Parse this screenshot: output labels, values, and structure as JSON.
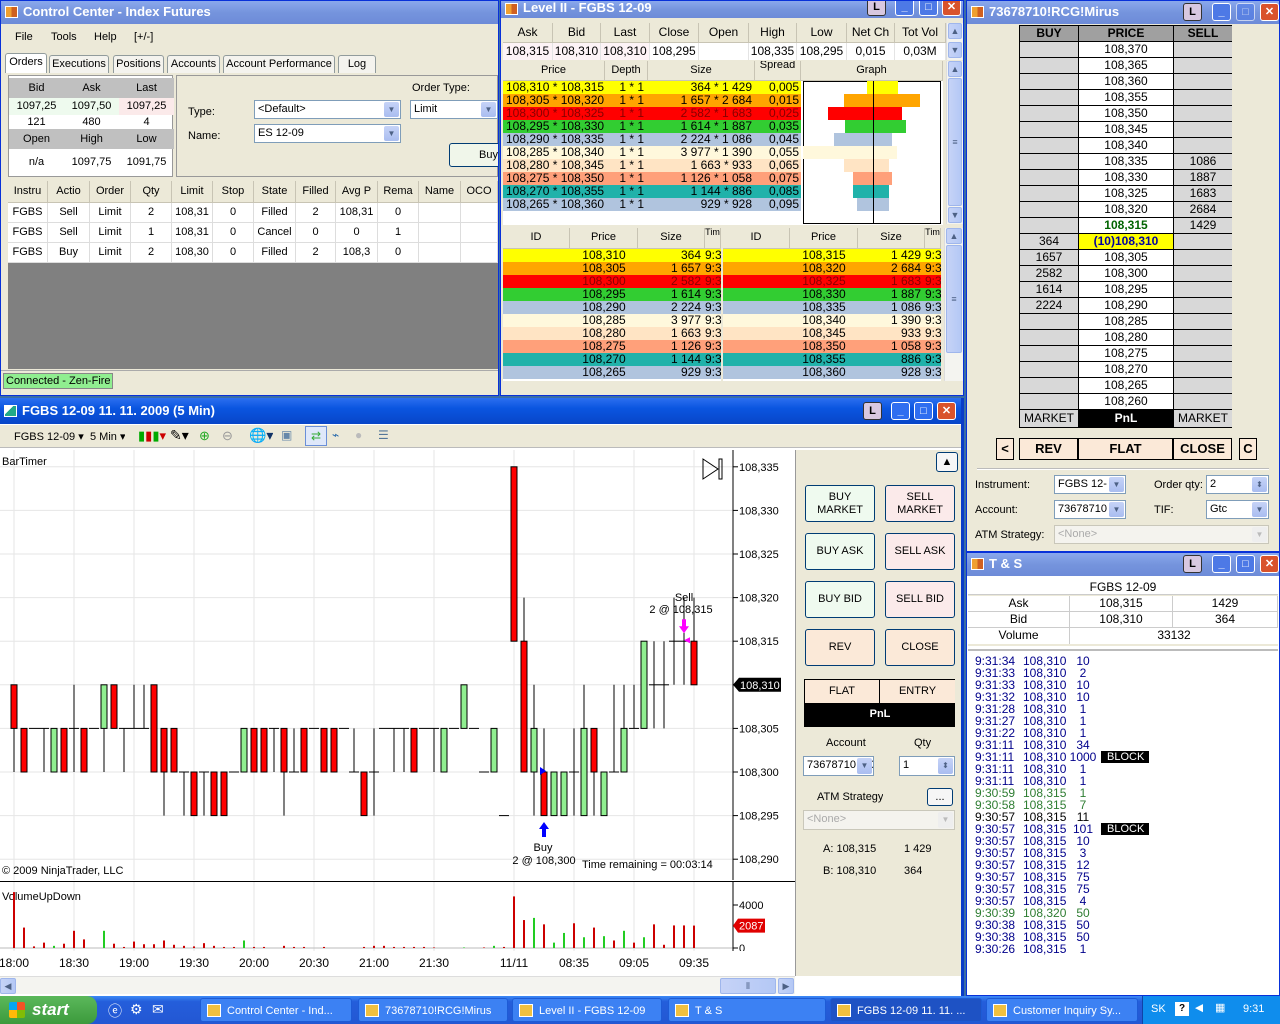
{
  "colors": {
    "up": "#90EE90",
    "down": "#FF0000",
    "book": [
      "#FFFF00",
      "#FFA500",
      "#FF0000",
      "#32CD32",
      "#B0C4DE",
      "#FFF8DC",
      "#FFE4C4",
      "#FFA07A",
      "#20B2AA",
      "#B0C4DE"
    ]
  },
  "control_center": {
    "title": "Control Center - Index Futures",
    "menu": [
      "File",
      "Tools",
      "Help",
      "[+/-]"
    ],
    "tabs": [
      "Orders",
      "Executions",
      "Positions",
      "Accounts",
      "Account Performance",
      "Log"
    ],
    "quote": {
      "headers": [
        "Bid",
        "Ask",
        "Last"
      ],
      "values": [
        "1097,25",
        "1097,50",
        "1097,25"
      ],
      "sizes": [
        "121",
        "480",
        "4"
      ],
      "headers2": [
        "Open",
        "High",
        "Low"
      ],
      "values2": [
        "n/a",
        "1097,75",
        "1091,75"
      ]
    },
    "order_entry": {
      "type_label": "Type:",
      "type_value": "<Default>",
      "name_label": "Name:",
      "name_value": "ES 12-09",
      "order_type_label": "Order Type:",
      "order_type_value": "Limit",
      "buy_label": "Buy"
    },
    "orders": {
      "columns": [
        "Instru",
        "Actio",
        "Order",
        "Qty",
        "Limit",
        "Stop",
        "State",
        "Filled",
        "Avg P",
        "Rema",
        "Name",
        "OCO"
      ],
      "rows": [
        [
          "FGBS",
          "Sell",
          "Limit",
          "2",
          "108,31",
          "0",
          "Filled",
          "2",
          "108,31",
          "0",
          "",
          ""
        ],
        [
          "FGBS",
          "Sell",
          "Limit",
          "1",
          "108,31",
          "0",
          "Cancel",
          "0",
          "0",
          "1",
          "",
          ""
        ],
        [
          "FGBS",
          "Buy",
          "Limit",
          "2",
          "108,30",
          "0",
          "Filled",
          "2",
          "108,3",
          "0",
          "",
          ""
        ]
      ]
    },
    "status": "Connected - Zen-Fire"
  },
  "level2": {
    "title": "Level II - FGBS 12-09",
    "summary": {
      "headers": [
        "Ask",
        "Bid",
        "Last",
        "Close",
        "Open",
        "High",
        "Low",
        "Net Ch",
        "Tot Vol"
      ],
      "values": [
        "108,315",
        "108,310",
        "108,310",
        "108,295",
        "",
        "108,335",
        "108,295",
        "0,015",
        "0,03M"
      ]
    },
    "book": {
      "columns": [
        "Price",
        "Depth",
        "Size",
        "Spread",
        "Graph"
      ],
      "rows": [
        {
          "price": "108,310 * 108,315",
          "depth": "1 * 1",
          "size": "364 * 1 429",
          "spread": "0,005",
          "bid": 364,
          "ask": 1429
        },
        {
          "price": "108,305 * 108,320",
          "depth": "1 * 1",
          "size": "1 657 * 2 684",
          "spread": "0,015",
          "bid": 1657,
          "ask": 2684
        },
        {
          "price": "108,300 * 108,325",
          "depth": "1 * 1",
          "size": "2 582 * 1 683",
          "spread": "0,025",
          "bid": 2582,
          "ask": 1683
        },
        {
          "price": "108,295 * 108,330",
          "depth": "1 * 1",
          "size": "1 614 * 1 887",
          "spread": "0,035",
          "bid": 1614,
          "ask": 1887
        },
        {
          "price": "108,290 * 108,335",
          "depth": "1 * 1",
          "size": "2 224 * 1 086",
          "spread": "0,045",
          "bid": 2224,
          "ask": 1086
        },
        {
          "price": "108,285 * 108,340",
          "depth": "1 * 1",
          "size": "3 977 * 1 390",
          "spread": "0,055",
          "bid": 3977,
          "ask": 1390
        },
        {
          "price": "108,280 * 108,345",
          "depth": "1 * 1",
          "size": "1 663 * 933",
          "spread": "0,065",
          "bid": 1663,
          "ask": 933
        },
        {
          "price": "108,275 * 108,350",
          "depth": "1 * 1",
          "size": "1 126 * 1 058",
          "spread": "0,075",
          "bid": 1126,
          "ask": 1058
        },
        {
          "price": "108,270 * 108,355",
          "depth": "1 * 1",
          "size": "1 144 * 886",
          "spread": "0,085",
          "bid": 1144,
          "ask": 886
        },
        {
          "price": "108,265 * 108,360",
          "depth": "1 * 1",
          "size": "929 * 928",
          "spread": "0,095",
          "bid": 929,
          "ask": 928
        }
      ]
    },
    "side_columns": [
      "ID",
      "Price",
      "Size",
      "Tim"
    ],
    "bids": [
      [
        "108,310",
        "364"
      ],
      [
        "108,305",
        "1 657"
      ],
      [
        "108,300",
        "2 582"
      ],
      [
        "108,295",
        "1 614"
      ],
      [
        "108,290",
        "2 224"
      ],
      [
        "108,285",
        "3 977"
      ],
      [
        "108,280",
        "1 663"
      ],
      [
        "108,275",
        "1 126"
      ],
      [
        "108,270",
        "1 144"
      ],
      [
        "108,265",
        "929"
      ]
    ],
    "asks": [
      [
        "108,315",
        "1 429"
      ],
      [
        "108,320",
        "2 684"
      ],
      [
        "108,325",
        "1 683"
      ],
      [
        "108,330",
        "1 887"
      ],
      [
        "108,335",
        "1 086"
      ],
      [
        "108,340",
        "1 390"
      ],
      [
        "108,345",
        "933"
      ],
      [
        "108,350",
        "1 058"
      ],
      [
        "108,355",
        "886"
      ],
      [
        "108,360",
        "928"
      ]
    ],
    "time_value": "9:3"
  },
  "dom": {
    "title": "73678710!RCG!Mirus",
    "columns": [
      "BUY",
      "PRICE",
      "SELL"
    ],
    "rows": [
      [
        "",
        "108,370",
        ""
      ],
      [
        "",
        "108,365",
        ""
      ],
      [
        "",
        "108,360",
        ""
      ],
      [
        "",
        "108,355",
        ""
      ],
      [
        "",
        "108,350",
        ""
      ],
      [
        "",
        "108,345",
        ""
      ],
      [
        "",
        "108,340",
        ""
      ],
      [
        "",
        "108,335",
        "1086"
      ],
      [
        "",
        "108,330",
        "1887"
      ],
      [
        "",
        "108,325",
        "1683"
      ],
      [
        "",
        "108,320",
        "2684"
      ],
      [
        "",
        "108,315",
        "1429"
      ],
      [
        "364",
        "(10)108,310",
        ""
      ],
      [
        "1657",
        "108,305",
        ""
      ],
      [
        "2582",
        "108,300",
        ""
      ],
      [
        "1614",
        "108,295",
        ""
      ],
      [
        "2224",
        "108,290",
        ""
      ],
      [
        "",
        "108,285",
        ""
      ],
      [
        "",
        "108,280",
        ""
      ],
      [
        "",
        "108,275",
        ""
      ],
      [
        "",
        "108,270",
        ""
      ],
      [
        "",
        "108,265",
        ""
      ],
      [
        "",
        "108,260",
        ""
      ]
    ],
    "last_index": 12,
    "ask_index": 11,
    "footer": [
      "MARKET",
      "PnL",
      "MARKET"
    ],
    "buttons": [
      "<",
      "REV",
      "FLAT",
      "CLOSE",
      "C"
    ],
    "instrument_label": "Instrument:",
    "instrument_value": "FGBS 12-",
    "account_label": "Account:",
    "account_value": "73678710",
    "qty_label": "Order qty:",
    "qty_value": "2",
    "tif_label": "TIF:",
    "tif_value": "Gtc",
    "atm_label": "ATM Strategy:",
    "atm_value": "<None>"
  },
  "ts": {
    "title": "T & S",
    "instrument": "FGBS 12-09",
    "rows": [
      [
        "Ask",
        "108,315",
        "1429"
      ],
      [
        "Bid",
        "108,310",
        "364"
      ]
    ],
    "volume_label": "Volume",
    "volume_value": "33132",
    "trades": [
      [
        "9:31:34",
        "108,310",
        "10",
        "",
        "b"
      ],
      [
        "9:31:33",
        "108,310",
        "2",
        "",
        "b"
      ],
      [
        "9:31:33",
        "108,310",
        "10",
        "",
        "b"
      ],
      [
        "9:31:32",
        "108,310",
        "10",
        "",
        "b"
      ],
      [
        "9:31:28",
        "108,310",
        "1",
        "",
        "b"
      ],
      [
        "9:31:27",
        "108,310",
        "1",
        "",
        "b"
      ],
      [
        "9:31:22",
        "108,310",
        "1",
        "",
        "b"
      ],
      [
        "9:31:11",
        "108,310",
        "34",
        "",
        "b"
      ],
      [
        "9:31:11",
        "108,310",
        "1000",
        "BLOCK",
        "b"
      ],
      [
        "9:31:11",
        "108,310",
        "1",
        "",
        "b"
      ],
      [
        "9:31:11",
        "108,310",
        "1",
        "",
        "b"
      ],
      [
        "9:30:59",
        "108,315",
        "1",
        "",
        "g"
      ],
      [
        "9:30:58",
        "108,315",
        "7",
        "",
        "g"
      ],
      [
        "9:30:57",
        "108,315",
        "11",
        "",
        "k"
      ],
      [
        "9:30:57",
        "108,315",
        "101",
        "BLOCK",
        "b"
      ],
      [
        "9:30:57",
        "108,315",
        "10",
        "",
        "b"
      ],
      [
        "9:30:57",
        "108,315",
        "3",
        "",
        "b"
      ],
      [
        "9:30:57",
        "108,315",
        "12",
        "",
        "b"
      ],
      [
        "9:30:57",
        "108,315",
        "75",
        "",
        "b"
      ],
      [
        "9:30:57",
        "108,315",
        "75",
        "",
        "b"
      ],
      [
        "9:30:57",
        "108,315",
        "4",
        "",
        "b"
      ],
      [
        "9:30:39",
        "108,320",
        "50",
        "",
        "g"
      ],
      [
        "9:30:38",
        "108,315",
        "50",
        "",
        "b"
      ],
      [
        "9:30:38",
        "108,315",
        "50",
        "",
        "b"
      ],
      [
        "9:30:26",
        "108,315",
        "1",
        "",
        "b"
      ]
    ]
  },
  "chart": {
    "title": "FGBS 12-09  11. 11. 2009 (5 Min)",
    "toolbar": {
      "instrument": "FGBS 12-09",
      "interval": "5 Min"
    },
    "bar_timer": "BarTimer",
    "copyright": "© 2009 NinjaTrader, LLC",
    "time_remaining": "Time remaining = 00:03:14",
    "indicator": "VolumeUpDown",
    "panel": {
      "buy_market": "BUY MARKET",
      "sell_market": "SELL MARKET",
      "buy_ask": "BUY ASK",
      "sell_ask": "SELL ASK",
      "buy_bid": "BUY BID",
      "sell_bid": "SELL BID",
      "rev": "REV",
      "close": "CLOSE",
      "flat": "FLAT",
      "entry": "ENTRY",
      "pnl": "PnL",
      "account_label": "Account",
      "account_value": "73678710!RC",
      "qty_label": "Qty",
      "qty_value": "1",
      "atm_label": "ATM Strategy",
      "atm_button": "...",
      "atm_value": "<None>",
      "ask_line": "A: 108,315",
      "ask_size": "1 429",
      "bid_line": "B: 108,310",
      "bid_size": "364"
    }
  },
  "chart_data": {
    "type": "candlestick",
    "title": "FGBS 12-09  11. 11. 2009 (5 Min)",
    "ylim": [
      108.29,
      108.335
    ],
    "y_ticks": [
      "108,290",
      "108,295",
      "108,300",
      "108,305",
      "108,310",
      "108,315",
      "108,320",
      "108,325",
      "108,330",
      "108,335"
    ],
    "last_price": "108,310",
    "last_price_value": 108.31,
    "x_labels": [
      {
        "i": 0,
        "t": "18:00"
      },
      {
        "i": 6,
        "t": "18:30"
      },
      {
        "i": 12,
        "t": "19:00"
      },
      {
        "i": 18,
        "t": "19:30"
      },
      {
        "i": 24,
        "t": "20:00"
      },
      {
        "i": 30,
        "t": "20:30"
      },
      {
        "i": 36,
        "t": "21:00"
      },
      {
        "i": 42,
        "t": "21:30"
      },
      {
        "i": 50,
        "t": "11/11"
      },
      {
        "i": 56,
        "t": "08:35"
      },
      {
        "i": 62,
        "t": "09:05"
      },
      {
        "i": 68,
        "t": "09:35"
      }
    ],
    "ohlc": [
      [
        108.31,
        108.31,
        108.3,
        108.305
      ],
      [
        108.305,
        108.305,
        108.3,
        108.3
      ],
      [
        108.305,
        108.305,
        108.305,
        108.305
      ],
      [
        108.305,
        108.305,
        108.3,
        108.305
      ],
      [
        108.3,
        108.305,
        108.3,
        108.305
      ],
      [
        108.305,
        108.305,
        108.3,
        108.3
      ],
      [
        108.305,
        108.31,
        108.3,
        108.305
      ],
      [
        108.305,
        108.305,
        108.3,
        108.3
      ],
      [
        108.305,
        108.305,
        108.305,
        108.305
      ],
      [
        108.305,
        108.31,
        108.3,
        108.31
      ],
      [
        108.31,
        108.31,
        108.305,
        108.305
      ],
      [
        108.305,
        108.305,
        108.3,
        108.305
      ],
      [
        108.305,
        108.31,
        108.305,
        108.305
      ],
      [
        108.305,
        108.31,
        108.305,
        108.305
      ],
      [
        108.31,
        108.31,
        108.3,
        108.3
      ],
      [
        108.305,
        108.305,
        108.295,
        108.3
      ],
      [
        108.305,
        108.305,
        108.3,
        108.3
      ],
      [
        108.3,
        108.3,
        108.295,
        108.3
      ],
      [
        108.3,
        108.3,
        108.295,
        108.295
      ],
      [
        108.3,
        108.3,
        108.295,
        108.3
      ],
      [
        108.3,
        108.3,
        108.295,
        108.295
      ],
      [
        108.3,
        108.3,
        108.295,
        108.295
      ],
      [
        108.3,
        108.3,
        108.3,
        108.3
      ],
      [
        108.3,
        108.305,
        108.3,
        108.305
      ],
      [
        108.305,
        108.305,
        108.3,
        108.3
      ],
      [
        108.305,
        108.305,
        108.3,
        108.3
      ],
      [
        108.305,
        108.305,
        108.3,
        108.305
      ],
      [
        108.305,
        108.305,
        108.295,
        108.3
      ],
      [
        108.3,
        108.305,
        108.3,
        108.3
      ],
      [
        108.305,
        108.305,
        108.3,
        108.3
      ],
      [
        108.305,
        108.305,
        108.305,
        108.305
      ],
      [
        108.305,
        108.305,
        108.3,
        108.3
      ],
      [
        108.305,
        108.305,
        108.3,
        108.3
      ],
      [
        108.305,
        108.305,
        108.305,
        108.305
      ],
      [
        108.3,
        108.305,
        108.3,
        108.3
      ],
      [
        108.3,
        108.3,
        108.295,
        108.295
      ],
      [
        108.3,
        108.305,
        108.295,
        108.3
      ],
      [
        108.305,
        108.305,
        108.305,
        108.305
      ],
      [
        108.305,
        108.305,
        108.3,
        108.305
      ],
      [
        108.305,
        108.305,
        108.3,
        108.305
      ],
      [
        108.305,
        108.305,
        108.3,
        108.3
      ],
      [
        108.305,
        108.305,
        108.305,
        108.305
      ],
      [
        108.305,
        108.305,
        108.3,
        108.305
      ],
      [
        108.3,
        108.305,
        108.3,
        108.305
      ],
      [
        108.305,
        108.305,
        108.305,
        108.305
      ],
      [
        108.305,
        108.31,
        108.305,
        108.31
      ],
      [
        108.305,
        108.305,
        108.305,
        108.305
      ],
      [
        108.3,
        108.3,
        108.3,
        108.3
      ],
      [
        108.3,
        108.305,
        108.3,
        108.305
      ],
      [
        108.295,
        108.295,
        108.295,
        108.295
      ],
      [
        108.335,
        108.335,
        108.315,
        108.315
      ],
      [
        108.315,
        108.32,
        108.3,
        108.3
      ],
      [
        108.3,
        108.31,
        108.295,
        108.305
      ],
      [
        108.3,
        108.305,
        108.295,
        108.295
      ],
      [
        108.295,
        108.3,
        108.295,
        108.3
      ],
      [
        108.295,
        108.3,
        108.295,
        108.3
      ],
      [
        108.3,
        108.305,
        108.295,
        108.3
      ],
      [
        108.295,
        108.31,
        108.295,
        108.305
      ],
      [
        108.305,
        108.305,
        108.295,
        108.3
      ],
      [
        108.295,
        108.3,
        108.295,
        108.3
      ],
      [
        108.3,
        108.31,
        108.3,
        108.3
      ],
      [
        108.3,
        108.31,
        108.3,
        108.305
      ],
      [
        108.305,
        108.31,
        108.305,
        108.305
      ],
      [
        108.305,
        108.315,
        108.305,
        108.315
      ],
      [
        108.31,
        108.315,
        108.305,
        108.31
      ],
      [
        108.31,
        108.315,
        108.305,
        108.31
      ],
      [
        108.315,
        108.32,
        108.31,
        108.315
      ],
      [
        108.315,
        108.32,
        108.31,
        108.315
      ],
      [
        108.315,
        108.32,
        108.31,
        108.31
      ]
    ],
    "volume": {
      "ylim": [
        0,
        4000
      ],
      "ticks": [
        "0",
        "4000"
      ],
      "last": "2087",
      "values": [
        5500,
        1900,
        150,
        500,
        200,
        400,
        1600,
        800,
        0,
        1600,
        400,
        100,
        600,
        350,
        350,
        700,
        300,
        200,
        150,
        450,
        200,
        100,
        100,
        700,
        100,
        100,
        0,
        200,
        100,
        100,
        0,
        100,
        0,
        0,
        0,
        100,
        200,
        200,
        100,
        100,
        100,
        100,
        50,
        0,
        0,
        50,
        0,
        50,
        200,
        100,
        4800,
        2600,
        2800,
        2200,
        500,
        1400,
        2300,
        1000,
        1900,
        1100,
        700,
        1600,
        500,
        1000,
        2200,
        300,
        2100,
        2100,
        2087
      ]
    },
    "executions": [
      {
        "i": 53,
        "side": "Buy",
        "label": "Buy",
        "detail": "2 @ 108,300",
        "price": 108.3
      },
      {
        "i": 67,
        "side": "Sell",
        "label": "Sell",
        "detail": "2 @ 108,315",
        "price": 108.315
      }
    ]
  },
  "taskbar": {
    "start": "start",
    "items": [
      "Control Center - Ind...",
      "73678710!RCG!Mirus",
      "Level II - FGBS 12-09",
      "T & S",
      "FGBS 12-09  11. 11. ...",
      "Customer Inquiry Sy..."
    ],
    "lang": "SK",
    "clock": "9:31"
  }
}
